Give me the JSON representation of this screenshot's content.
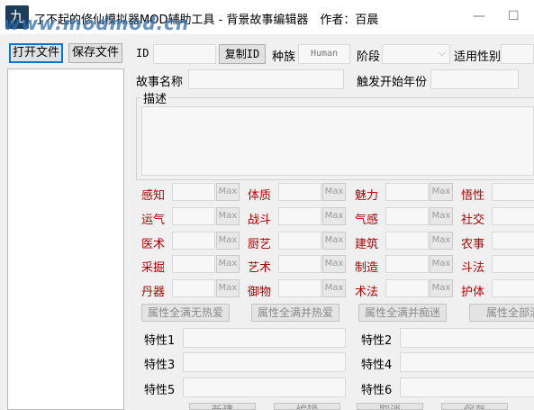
{
  "window": {
    "title": "了不起的修仙模拟器MOD辅助工具 - 背景故事编辑器　作者：百晨",
    "watermark": "www.modmod.cn",
    "app_icon_glyph": "九",
    "minimize_glyph": "—",
    "maximize_glyph": "☐"
  },
  "left_panel": {
    "open_file": "打开文件",
    "save_file": "保存文件"
  },
  "top_row": {
    "id_label": "ID",
    "copy_id": "复制ID",
    "race_label": "种族",
    "race_value": "Human",
    "stage_label": "阶段",
    "gender_label": "适用性别"
  },
  "story_row": {
    "story_name_label": "故事名称",
    "trigger_year_label": "触发开始年份"
  },
  "description": {
    "label": "描述"
  },
  "attributes": {
    "max_label": "Max",
    "rows": [
      [
        "感知",
        "体质",
        "魅力",
        "悟性"
      ],
      [
        "运气",
        "战斗",
        "气感",
        "社交"
      ],
      [
        "医术",
        "厨艺",
        "建筑",
        "农事"
      ],
      [
        "采掘",
        "艺术",
        "制造",
        "斗法"
      ],
      [
        "丹器",
        "御物",
        "术法",
        "护体"
      ]
    ]
  },
  "preset_buttons": [
    "属性全满无热爱",
    "属性全满并热爱",
    "属性全满并痴迷",
    "属性全部清"
  ],
  "traits": [
    "特性1",
    "特性2",
    "特性3",
    "特性4",
    "特性5",
    "特性6"
  ],
  "bottom_buttons": [
    "新建",
    "编辑",
    "取消",
    "保存"
  ],
  "colors": {
    "attribute_label": "#b40000",
    "focus_border": "#0078d7"
  }
}
